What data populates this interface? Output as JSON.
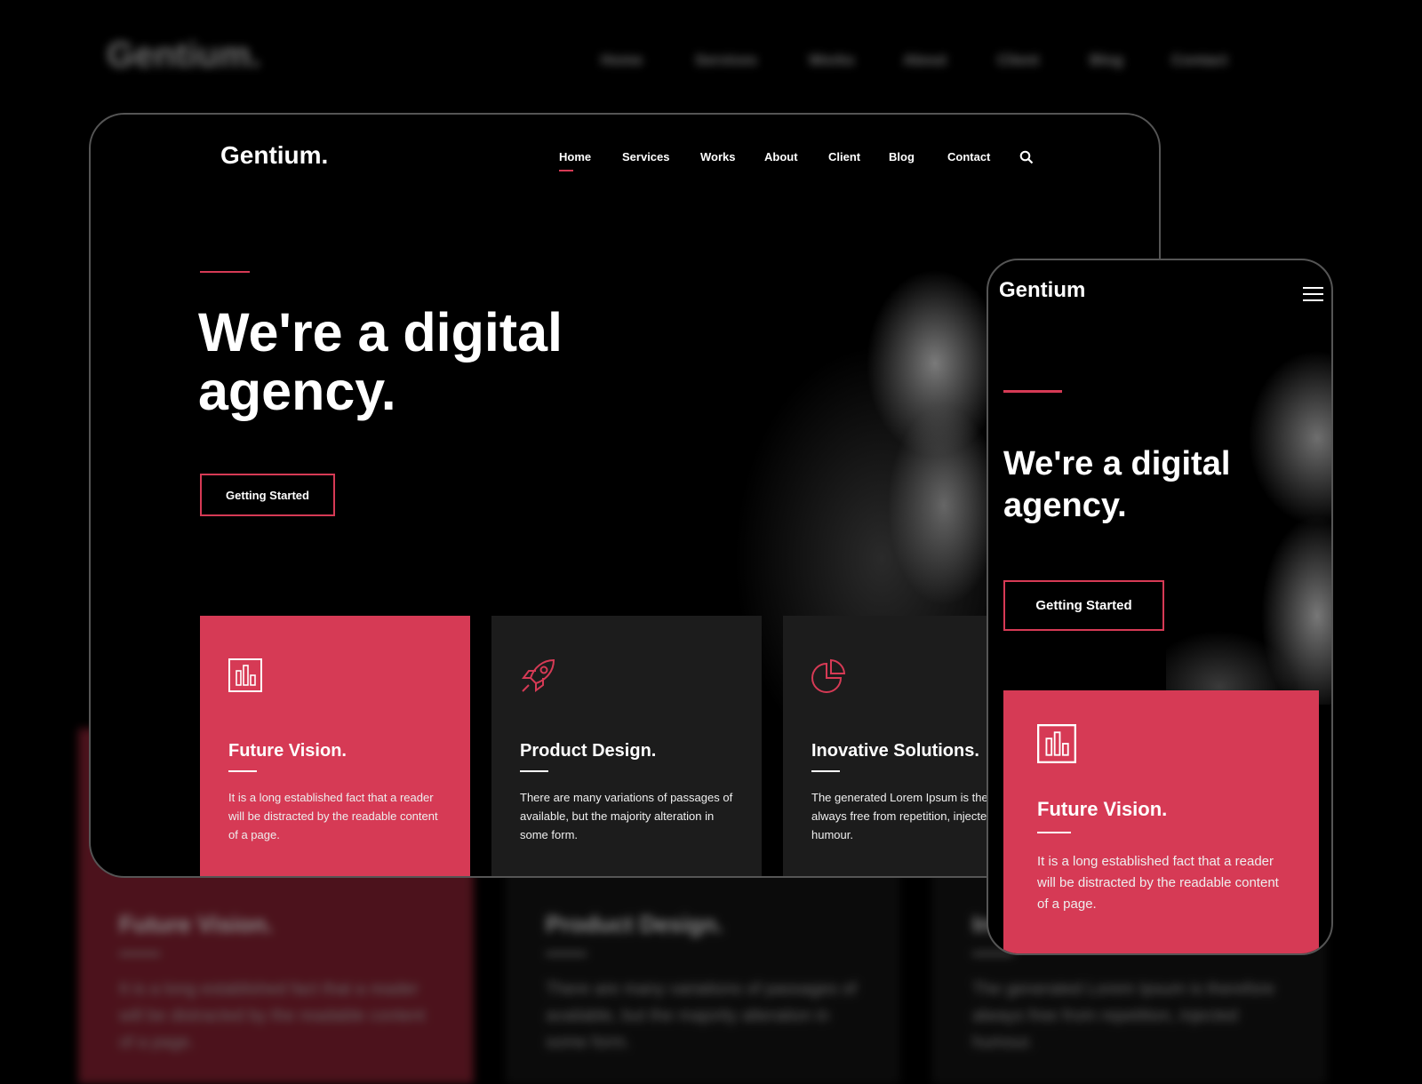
{
  "brand": {
    "logo": "Gentium.",
    "mobile_logo": "Gentium",
    "accent": "#d63a55"
  },
  "nav": {
    "items": [
      "Home",
      "Services",
      "Works",
      "About",
      "Client",
      "Blog",
      "Contact"
    ],
    "active": "Home",
    "search_icon": "search-icon"
  },
  "hero": {
    "line1": "We're a digital",
    "line2": "agency.",
    "cta": "Getting Started"
  },
  "cards": [
    {
      "icon": "bar-chart-icon",
      "title": "Future Vision.",
      "text": "It is a long established fact that a reader will be distracted by the readable content of a page.",
      "color": "#d63a55"
    },
    {
      "icon": "rocket-icon",
      "title": "Product Design.",
      "text": "There are many variations of passages of available, but the majority alteration in some form.",
      "color": "#1c1c1c"
    },
    {
      "icon": "pie-chart-icon",
      "title": "Inovative Solutions.",
      "text": "The generated Lorem Ipsum is therefore always free from repetition, injected humour.",
      "color": "#1c1c1c"
    }
  ],
  "mobile": {
    "menu_icon": "hamburger-icon"
  }
}
